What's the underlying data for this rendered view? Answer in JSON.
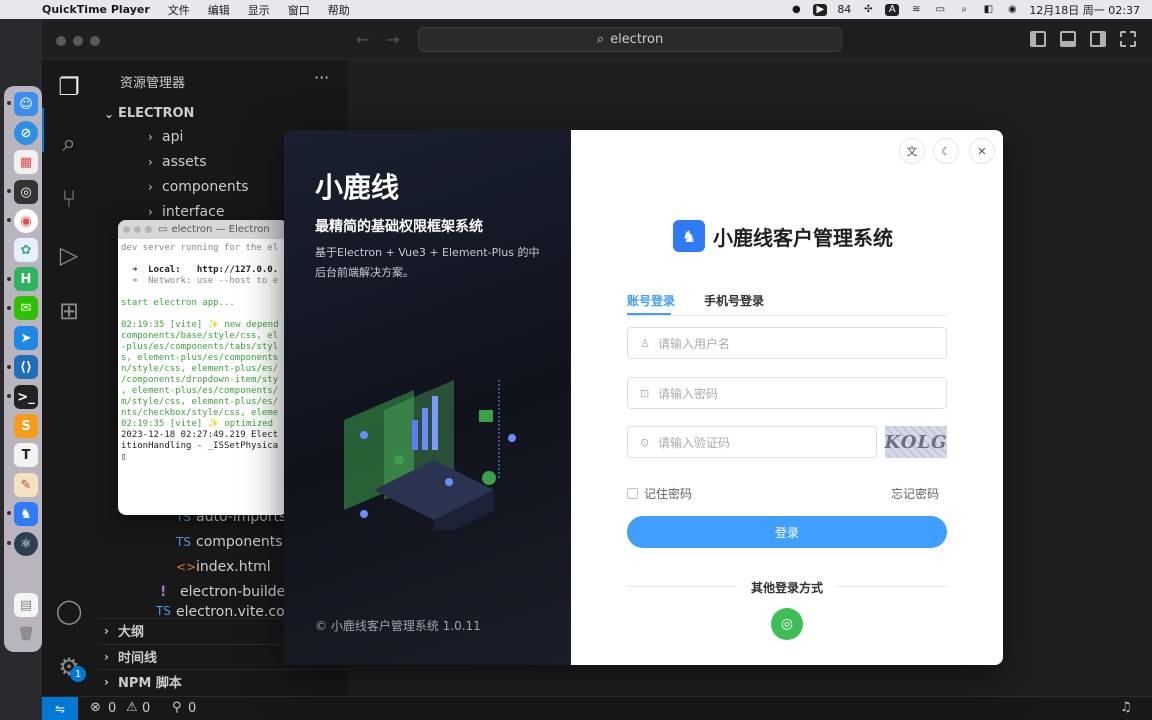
{
  "menubar": {
    "app": "QuickTime Player",
    "items": [
      "文件",
      "编辑",
      "显示",
      "窗口",
      "帮助"
    ],
    "battery_count": "84",
    "datetime": "12月18日 周一  02:37"
  },
  "titlebar": {
    "search": "electron"
  },
  "explorer": {
    "title": "资源管理器",
    "more": "···",
    "root": "ELECTRON",
    "folders": [
      "api",
      "assets",
      "components",
      "interface"
    ],
    "files": [
      {
        "icon": "TS",
        "name": "auto-imports.d.ts"
      },
      {
        "icon": "TS",
        "name": "components.d.ts"
      },
      {
        "icon": "<>",
        "name": "index.html"
      }
    ],
    "root_files": [
      {
        "icon": "!",
        "name": "electron-builder.yml"
      },
      {
        "icon": "TS",
        "name": "electron.vite.config.ts"
      }
    ],
    "sections": [
      "大纲",
      "时间线",
      "NPM 脚本"
    ]
  },
  "activity": {
    "badge": "1"
  },
  "statusbar": {
    "errors": "0",
    "warnings": "0",
    "ports": "0"
  },
  "terminal": {
    "title": "electron — Electron",
    "lines": [
      {
        "cls": "tgray",
        "text": "dev server running for the el"
      },
      {
        "cls": "",
        "text": ""
      },
      {
        "cls": "tb",
        "text": "  ➜  Local:   http://127.0.0."
      },
      {
        "cls": "tgray",
        "text": "  ➜  Network: use --host to e"
      },
      {
        "cls": "",
        "text": ""
      },
      {
        "cls": "tg",
        "text": "start electron app..."
      },
      {
        "cls": "",
        "text": ""
      },
      {
        "cls": "tg",
        "text": "02:19:35 [vite] ✨ new depend"
      },
      {
        "cls": "tg",
        "text": "components/base/style/css, el"
      },
      {
        "cls": "tg",
        "text": "-plus/es/components/tabs/styl"
      },
      {
        "cls": "tg",
        "text": "s, element-plus/es/components"
      },
      {
        "cls": "tg",
        "text": "n/style/css, element-plus/es/"
      },
      {
        "cls": "tg",
        "text": "/components/dropdown-item/sty"
      },
      {
        "cls": "tg",
        "text": ", element-plus/es/components/"
      },
      {
        "cls": "tg",
        "text": "m/style/css, element-plus/es/"
      },
      {
        "cls": "tg",
        "text": "nts/checkbox/style/css, eleme"
      },
      {
        "cls": "tg",
        "text": "02:19:35 [vite] ✨ optimized"
      },
      {
        "cls": "",
        "text": "2023-12-18 02:27:49.219 Elect"
      },
      {
        "cls": "",
        "text": "itionHandling - _ISSetPhysica"
      },
      {
        "cls": "",
        "text": "▯"
      }
    ]
  },
  "login": {
    "brand_title": "小鹿线",
    "brand_subtitle": "最精简的基础权限框架系统",
    "brand_desc": "基于Electron + Vue3 + Element-Plus 的中后台前端解决方案。",
    "copyright": "© 小鹿线客户管理系统 1.0.11",
    "system_name": "小鹿线客户管理系统",
    "tabs": [
      "账号登录",
      "手机号登录"
    ],
    "username_placeholder": "请输入用户名",
    "password_placeholder": "请输入密码",
    "captcha_placeholder": "请输入验证码",
    "captcha_text": "KOLG",
    "remember": "记住密码",
    "forgot": "忘记密码",
    "login_button": "登录",
    "other_methods": "其他登录方式"
  }
}
